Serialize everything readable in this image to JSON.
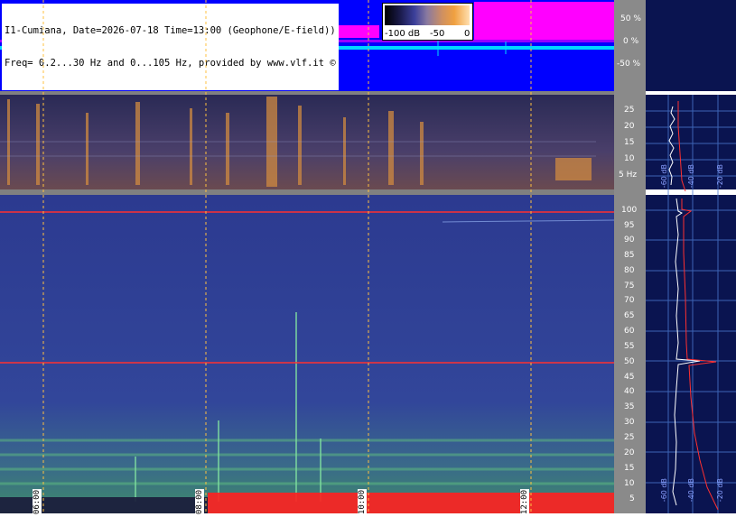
{
  "header": {
    "line1": "I1-Cumiana, Date=2026-07-18 Time=13:00 (Geophone/E-field))",
    "line2": "Freq= 0.2...30 Hz and 0...105 Hz, provided by www.vlf.it ©"
  },
  "colorbar": {
    "label_min": "-100 dB",
    "label_mid": "-50",
    "label_max": "0"
  },
  "waveform_axis": [
    "50 %",
    "0 %",
    "-50 %"
  ],
  "low_freq_axis": [
    "25",
    "20",
    "15",
    "10",
    "5 Hz"
  ],
  "high_freq_axis": [
    "100",
    "95",
    "90",
    "85",
    "80",
    "75",
    "70",
    "65",
    "60",
    "55",
    "50",
    "45",
    "40",
    "35",
    "30",
    "25",
    "20",
    "15",
    "10",
    "5"
  ],
  "time_labels": [
    "06:00",
    "08:00",
    "10:00",
    "12:00"
  ],
  "side_labels_top": [
    "-60 dB",
    "-40 dB",
    "-20 dB"
  ],
  "side_labels_bottom": [
    "-60 dB",
    "-40 dB",
    "-20 dB"
  ],
  "colors": {
    "waveform_bg": "#0000ff",
    "waveform_trace": "#00e0ff",
    "waveform_envelope": "#ff00ff",
    "spectrogram_low": "#24254e",
    "spectrogram_high": "#2b3a8c",
    "hum_line": "#ff3030",
    "marker_line": "#ffc040",
    "panel_bg": "#0a1450"
  }
}
